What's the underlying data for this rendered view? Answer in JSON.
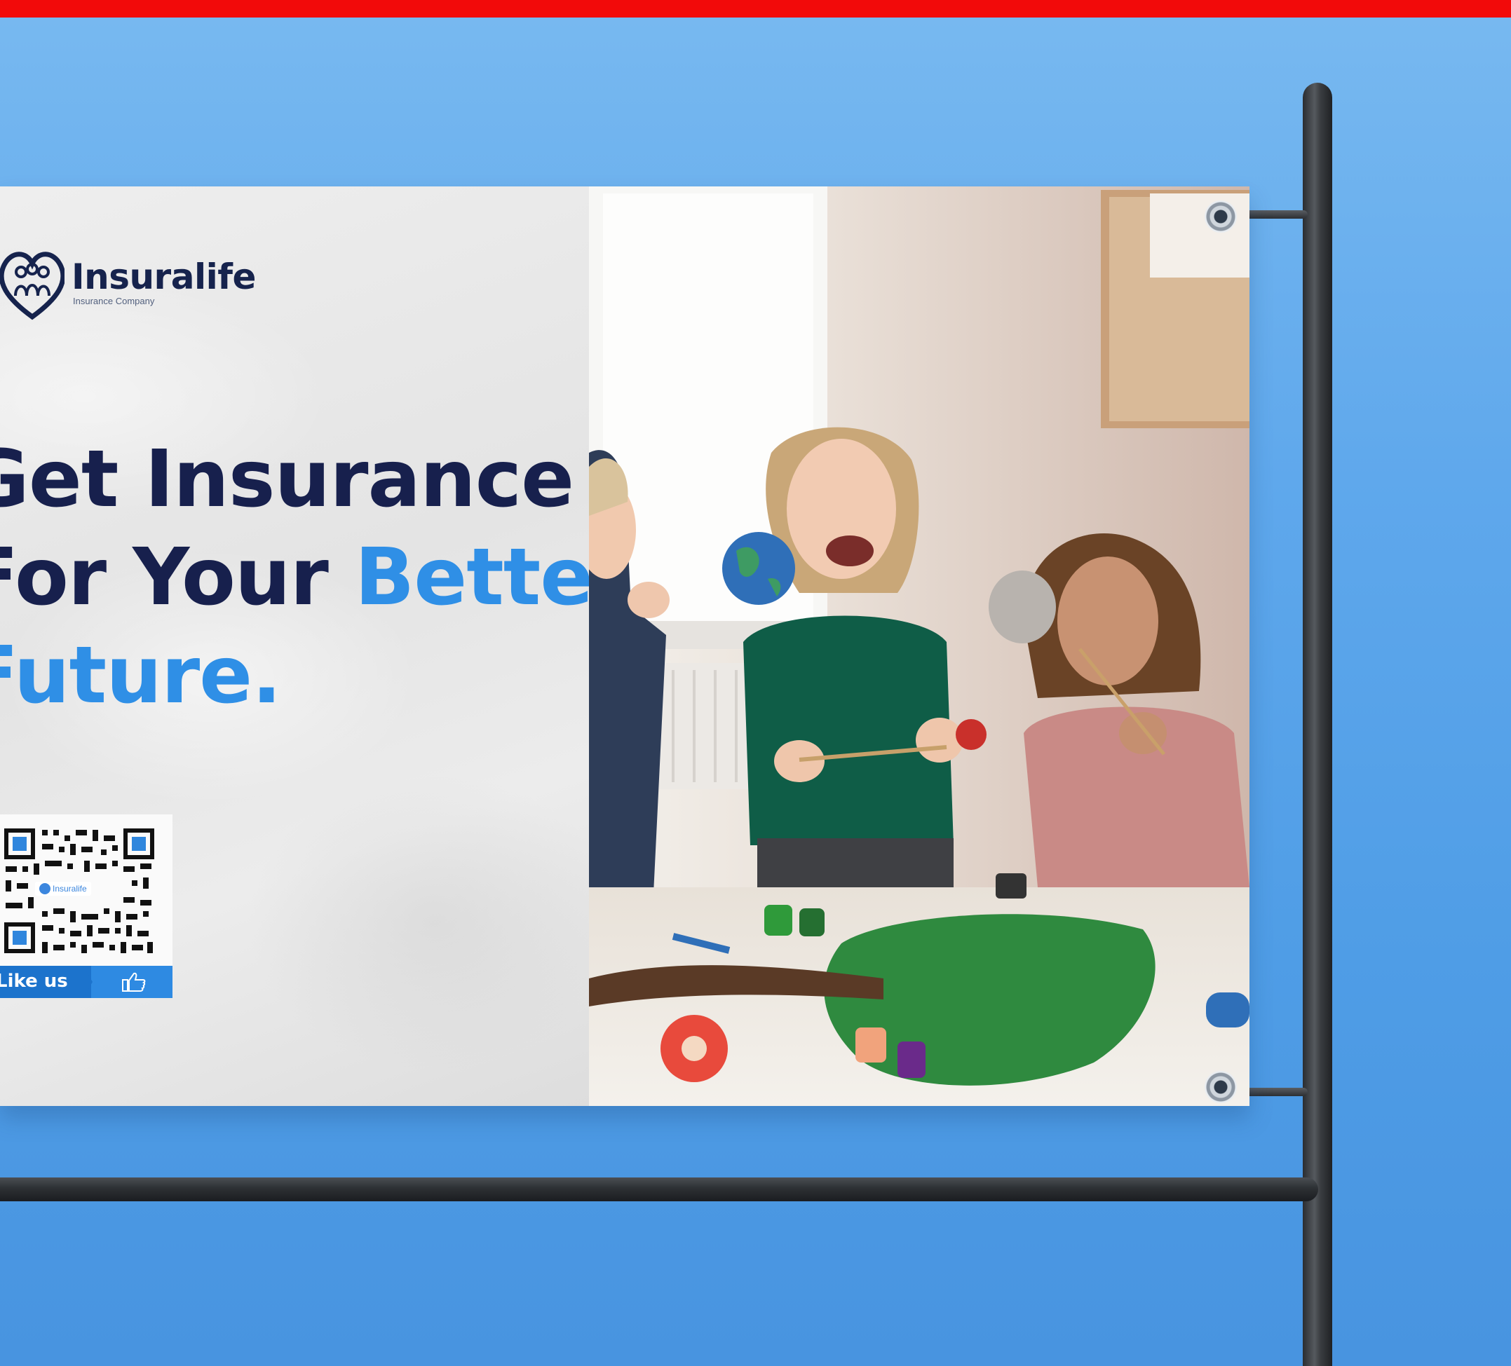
{
  "brand": {
    "name": "Insuralife",
    "tagline": "Insurance Company"
  },
  "headline": {
    "line1": "Get Insurance",
    "line2_main": "For Your ",
    "line2_accent": "Better",
    "line3_accent": "Future."
  },
  "qr": {
    "badge_text": "Insuralife",
    "like_label": "Like us"
  },
  "colors": {
    "top_bar": "#f20a0a",
    "background": "#5fa8ec",
    "headline_dark": "#17204d",
    "headline_accent": "#2f8fe6",
    "like_bar": "#1c73cc"
  },
  "icons": [
    "heart-family-logo-icon",
    "qr-code",
    "thumbs-up-icon",
    "grommet"
  ]
}
